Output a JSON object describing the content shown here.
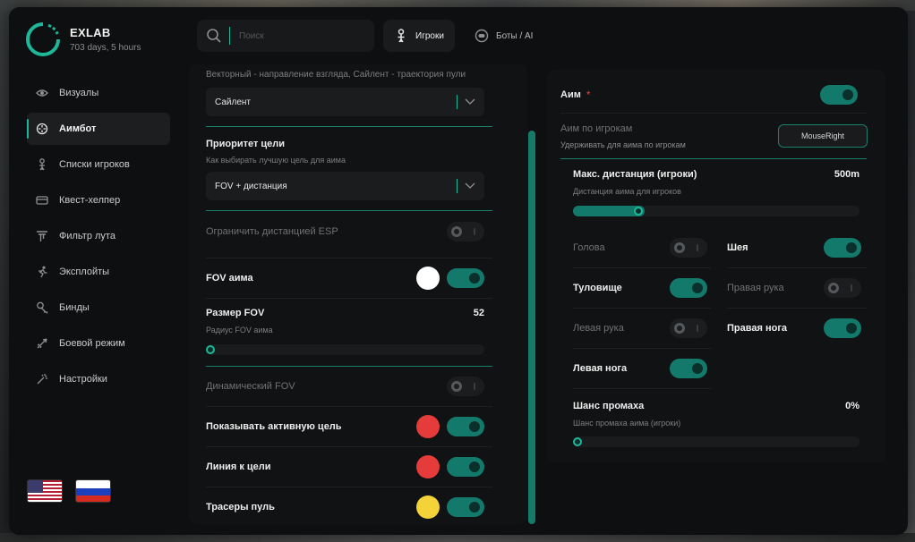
{
  "brand": {
    "title": "EXLAB",
    "subtitle": "703 days, 5 hours"
  },
  "sidebar": {
    "items": [
      {
        "label": "Визуалы",
        "icon": "eye-icon",
        "active": false
      },
      {
        "label": "Аимбот",
        "icon": "crosshair-icon",
        "active": true
      },
      {
        "label": "Списки игроков",
        "icon": "person-icon",
        "active": false
      },
      {
        "label": "Квест-хелпер",
        "icon": "card-icon",
        "active": false
      },
      {
        "label": "Фильтр лута",
        "icon": "filter-icon",
        "active": false
      },
      {
        "label": "Эксплойты",
        "icon": "running-icon",
        "active": false
      },
      {
        "label": "Бинды",
        "icon": "key-icon",
        "active": false
      },
      {
        "label": "Боевой режим",
        "icon": "rocket-icon",
        "active": false
      },
      {
        "label": "Настройки",
        "icon": "wand-icon",
        "active": false
      }
    ],
    "flags": [
      "us-flag-icon",
      "ru-flag-icon"
    ]
  },
  "topbar": {
    "search_placeholder": "Поиск",
    "tabs": [
      {
        "label": "Игроки",
        "icon": "person-icon",
        "active": true
      },
      {
        "label": "Боты / AI",
        "icon": "bot-icon",
        "active": false
      }
    ]
  },
  "mid": {
    "mode_hint": "Векторный - направление взгляда, Сайлент - траектория пули",
    "mode_value": "Сайлент",
    "priority_label": "Приоритет цели",
    "priority_sub": "Как выбирать лучшую цель для аима",
    "priority_value": "FOV + дистанция",
    "limit_esp_label": "Ограничить дистанцией ESP",
    "fov_label": "FOV аима",
    "fov_size_label": "Размер FOV",
    "fov_size_sub": "Радиус FOV аима",
    "fov_size_value": "52",
    "fov_size_fraction": 0.02,
    "dynamic_fov_label": "Динамический FOV",
    "show_target_label": "Показывать активную цель",
    "line_label": "Линия к цели",
    "tracers_label": "Трасеры пуль",
    "colors": {
      "fov": "#ffffff",
      "target": "#e63b3b",
      "line": "#e63b3b",
      "tracers": "#f3d338"
    }
  },
  "right": {
    "aim_label": "Аим",
    "aim_required": "*",
    "aim_players_label": "Аим по игрокам",
    "aim_players_sub": "Удерживать для аима по игрокам",
    "aim_key": "MouseRight",
    "max_dist_label": "Макс. дистанция (игроки)",
    "max_dist_sub": "Дистанция аима для игроков",
    "max_dist_value": "500m",
    "max_dist_fraction": 0.23,
    "parts": [
      {
        "label": "Голова",
        "on": false
      },
      {
        "label": "Шея",
        "on": true
      },
      {
        "label": "Туловище",
        "on": true
      },
      {
        "label": "Правая рука",
        "on": false
      },
      {
        "label": "Левая рука",
        "on": false
      },
      {
        "label": "Правая нога",
        "on": true
      },
      {
        "label": "Левая нога",
        "on": true
      }
    ],
    "miss_label": "Шанс промаха",
    "miss_sub": "Шанс промаха аима (игроки)",
    "miss_value": "0%",
    "miss_fraction": 0.0
  },
  "accent": "#1db89a"
}
